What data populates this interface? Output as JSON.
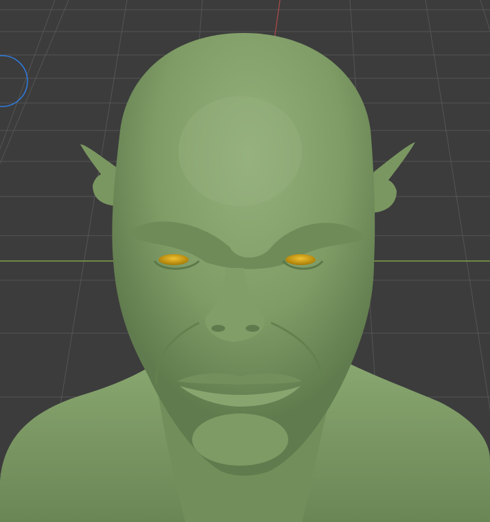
{
  "viewport": {
    "mode": "sculpt",
    "background_color": "#3c3c3c",
    "grid_line_color": "#555555",
    "x_axis_color": "#7fa34a",
    "y_axis_color": "#b24a4a",
    "brush_cursor_color": "#2f7bdc"
  },
  "model": {
    "name": "goblin-bust",
    "skin_color": "#7e9c66",
    "eye_color": "#d4a10b"
  }
}
